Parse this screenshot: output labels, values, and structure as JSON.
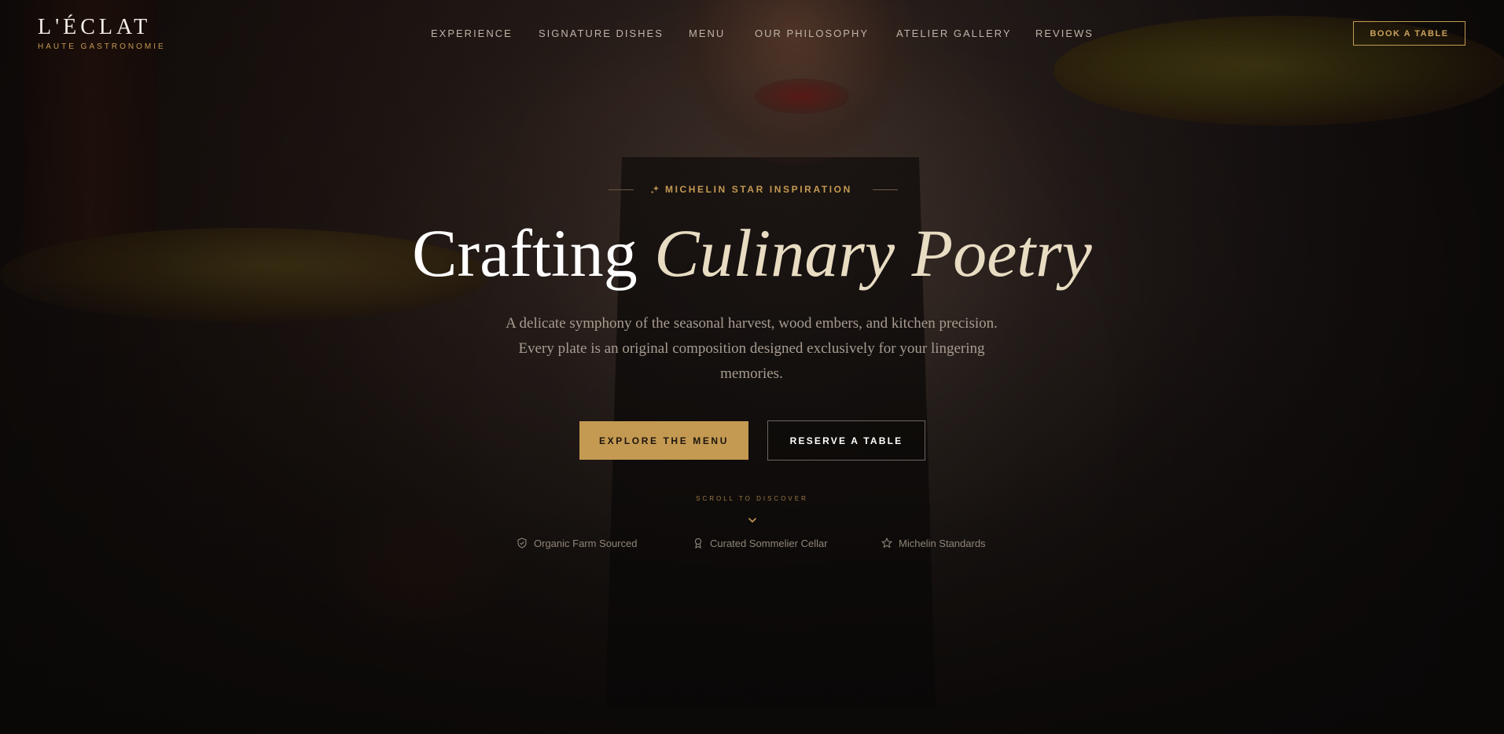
{
  "brand": {
    "name": "L'ÉCLAT",
    "tagline": "HAUTE GASTRONOMIE"
  },
  "nav": {
    "items": [
      {
        "label": "EXPERIENCE"
      },
      {
        "label": "SIGNATURE DISHES"
      },
      {
        "label": "MENU"
      },
      {
        "label": "OUR PHILOSOPHY"
      },
      {
        "label": "ATELIER GALLERY"
      },
      {
        "label": "REVIEWS"
      }
    ],
    "cta_label": "BOOK A TABLE"
  },
  "hero": {
    "eyebrow": "MICHELIN STAR INSPIRATION",
    "eyebrow_icon": "sparkle-icon",
    "headline_main": "Crafting",
    "headline_accent": "Culinary Poetry",
    "subtitle": "A delicate symphony of the seasonal harvest, wood embers, and kitchen precision. Every plate is an original composition designed exclusively for your lingering memories.",
    "primary_cta": "EXPLORE THE MENU",
    "secondary_cta": "RESERVE A TABLE",
    "scroll_hint": "SCROLL TO DISCOVER",
    "scroll_icon": "chevron-down-icon"
  },
  "features": [
    {
      "label": "Organic Farm Sourced",
      "icon": "shield-check-icon"
    },
    {
      "label": "Curated Sommelier Cellar",
      "icon": "award-icon"
    },
    {
      "label": "Michelin Standards",
      "icon": "star-icon"
    }
  ],
  "colors": {
    "accent_gold": "#c49a52",
    "headline_accent": "#e8dcc2",
    "background": "#0d0b0a",
    "nav_text": "#bfb4a8"
  }
}
